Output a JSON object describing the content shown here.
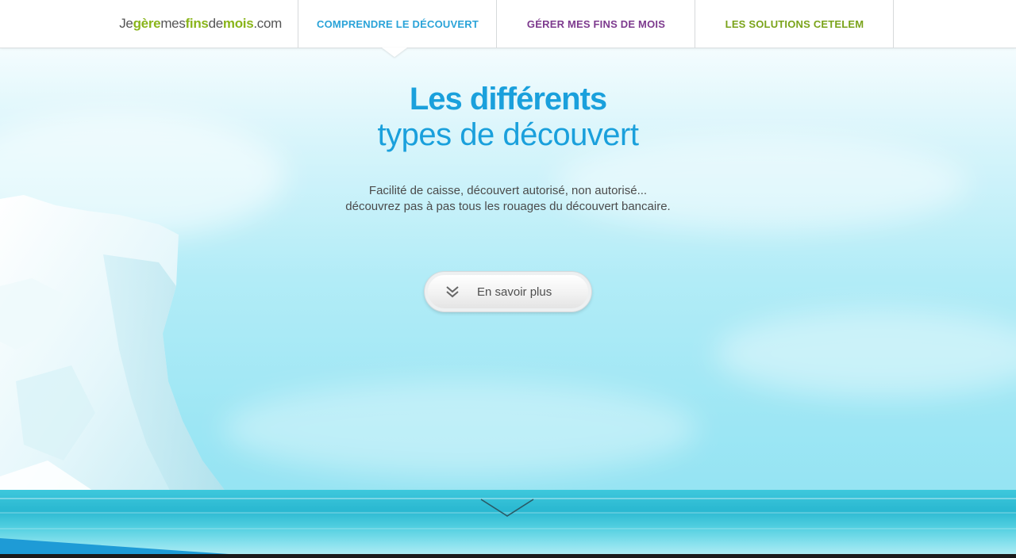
{
  "header": {
    "logo": {
      "je": "Je",
      "gere": "gère",
      "mes": "mes",
      "fins": "fins",
      "de": "de",
      "mois": "mois",
      "dotcom": ".com"
    },
    "nav": [
      {
        "label": "COMPRENDRE LE DÉCOUVERT",
        "color": "#2aa3d8",
        "active": true
      },
      {
        "label": "GÉRER MES FINS DE MOIS",
        "color": "#7d3a8e",
        "active": false
      },
      {
        "label": "LES SOLUTIONS CETELEM",
        "color": "#7aa31a",
        "active": false
      }
    ]
  },
  "hero": {
    "title_line1": "Les différents",
    "title_line2": "types de découvert",
    "intro_line1": "Facilité de caisse, découvert autorisé, non autorisé...",
    "intro_line2": "découvrez pas à pas tous les rouages du découvert bancaire.",
    "cta_label": "En savoir plus",
    "cta_icon": "double-chevron-down-icon",
    "scroll_icon": "chevron-down-icon"
  },
  "colors": {
    "accent_blue": "#1aa0dc",
    "purple": "#7d3a8e",
    "green": "#7aa31a"
  }
}
